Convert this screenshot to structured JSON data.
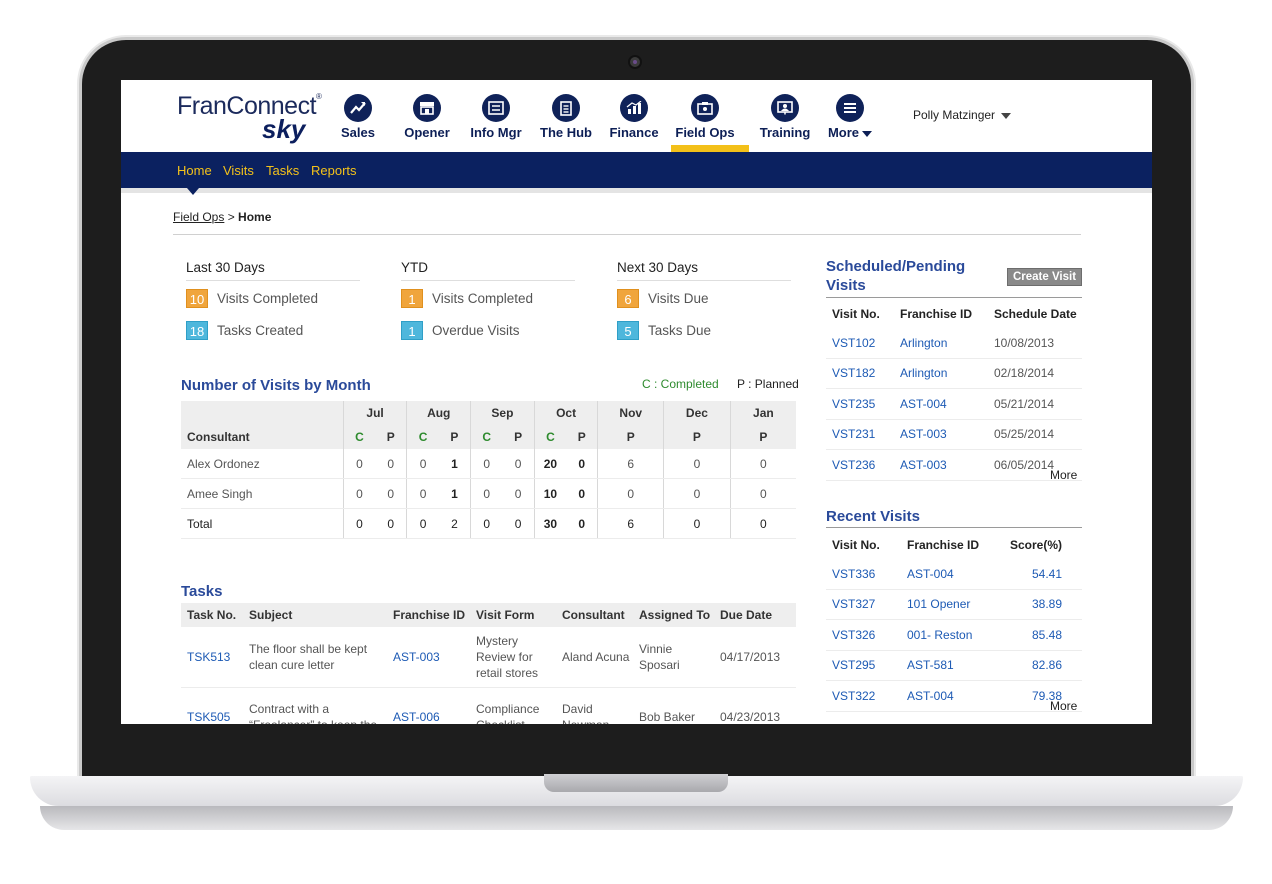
{
  "app": {
    "logo_top": "FranConnect",
    "logo_bottom": "sky",
    "nav": [
      {
        "label": "Sales",
        "icon": "sales-chart-icon"
      },
      {
        "label": "Opener",
        "icon": "storefront-icon"
      },
      {
        "label": "Info Mgr",
        "icon": "info-manager-icon"
      },
      {
        "label": "The Hub",
        "icon": "hub-document-icon"
      },
      {
        "label": "Finance",
        "icon": "finance-chart-icon"
      },
      {
        "label": "Field Ops",
        "icon": "field-ops-icon"
      },
      {
        "label": "Training",
        "icon": "training-icon"
      },
      {
        "label": "More",
        "icon": "menu-icon"
      }
    ],
    "active_nav": "Field Ops",
    "user": "Polly Matzinger",
    "subnav": [
      "Home",
      "Visits",
      "Tasks",
      "Reports"
    ],
    "breadcrumb_parent": "Field Ops",
    "breadcrumb_current": "Home",
    "colors": {
      "navy": "#0b2160",
      "accent": "#f3c019",
      "link": "#1d5ab4",
      "title": "#2a4a9a"
    }
  },
  "summary": [
    {
      "heading": "Last 30 Days",
      "items": [
        {
          "count": "10",
          "label": "Visits Completed",
          "color": "orange"
        },
        {
          "count": "18",
          "label": "Tasks Created",
          "color": "blue"
        }
      ]
    },
    {
      "heading": "YTD",
      "items": [
        {
          "count": "1",
          "label": "Visits Completed",
          "color": "orange"
        },
        {
          "count": "1",
          "label": "Overdue Visits",
          "color": "blue"
        }
      ]
    },
    {
      "heading": "Next 30 Days",
      "items": [
        {
          "count": "6",
          "label": "Visits Due",
          "color": "orange"
        },
        {
          "count": "5",
          "label": "Tasks Due",
          "color": "blue"
        }
      ]
    }
  ],
  "visits_by_month": {
    "title": "Number of Visits by Month",
    "legend_completed": "C : Completed",
    "legend_planned": "P : Planned",
    "consultant_header": "Consultant",
    "months": [
      "Jul",
      "Aug",
      "Sep",
      "Oct",
      "Nov",
      "Dec",
      "Jan"
    ],
    "sub_c": "C",
    "sub_p": "P",
    "rows": [
      {
        "name": "Alex Ordonez",
        "vals": [
          "0",
          "0",
          "0",
          "1",
          "0",
          "0",
          "20",
          "0",
          "6",
          "0",
          "0"
        ]
      },
      {
        "name": "Amee Singh",
        "vals": [
          "0",
          "0",
          "0",
          "1",
          "0",
          "0",
          "10",
          "0",
          "0",
          "0",
          "0"
        ]
      },
      {
        "name": "Total",
        "vals": [
          "0",
          "0",
          "0",
          "2",
          "0",
          "0",
          "30",
          "0",
          "6",
          "0",
          "0"
        ]
      }
    ]
  },
  "tasks": {
    "title": "Tasks",
    "headers": [
      "Task No.",
      "Subject",
      "Franchise ID",
      "Visit Form",
      "Consultant",
      "Assigned To",
      "Due Date"
    ],
    "rows": [
      {
        "no": "TSK513",
        "subject": "The floor shall be kept clean cure letter",
        "franchise": "AST-003",
        "form": "Mystery Review for retail stores",
        "consultant": "Aland Acuna",
        "assigned": "Vinnie Sposari",
        "due": "04/17/2013"
      },
      {
        "no": "TSK505",
        "subject": "Contract with a “Freelancer” to keep the",
        "franchise": "AST-006",
        "form": "Compliance Checklist",
        "consultant": "David Newman",
        "assigned": "Bob Baker",
        "due": "04/23/2013"
      }
    ]
  },
  "scheduled": {
    "title": "Scheduled/Pending Visits",
    "create_button": "Create Visit",
    "headers": [
      "Visit No.",
      "Franchise ID",
      "Schedule Date"
    ],
    "rows": [
      [
        "VST102",
        "Arlington",
        "10/08/2013"
      ],
      [
        "VST182",
        "Arlington",
        "02/18/2014"
      ],
      [
        "VST235",
        "AST-004",
        "05/21/2014"
      ],
      [
        "VST231",
        "AST-003",
        "05/25/2014"
      ],
      [
        "VST236",
        "AST-003",
        "06/05/2014"
      ]
    ],
    "more": "More"
  },
  "recent": {
    "title": "Recent Visits",
    "headers": [
      "Visit No.",
      "Franchise ID",
      "Score(%)"
    ],
    "rows": [
      [
        "VST336",
        "AST-004",
        "54.41"
      ],
      [
        "VST327",
        "101 Opener",
        "38.89"
      ],
      [
        "VST326",
        "001- Reston",
        "85.48"
      ],
      [
        "VST295",
        "AST-581",
        "82.86"
      ],
      [
        "VST322",
        "AST-004",
        "79.38"
      ]
    ],
    "more": "More"
  }
}
